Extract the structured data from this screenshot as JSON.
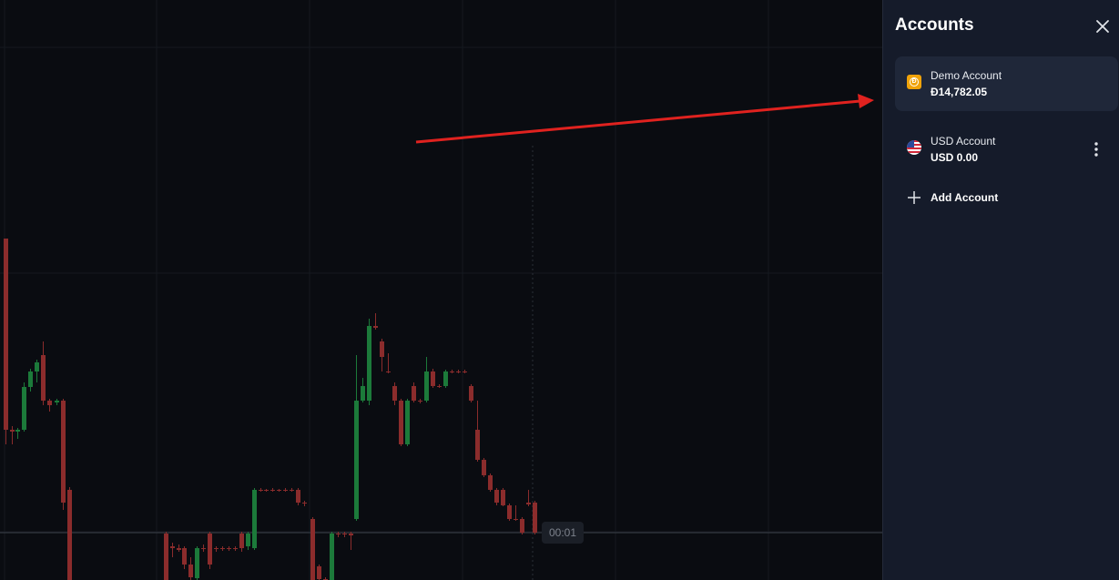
{
  "chart": {
    "timer": "00:01",
    "colors": {
      "up": "#1c7a3a",
      "down": "#8b2c2c",
      "grid": "#151920"
    }
  },
  "panel": {
    "title": "Accounts",
    "close_icon": "close-icon",
    "accounts": [
      {
        "name": "Demo Account",
        "balance": "Đ14,782.05",
        "icon": "demo-coin-icon",
        "active": true
      },
      {
        "name": "USD Account",
        "balance": "USD 0.00",
        "icon": "us-flag-icon",
        "active": false
      }
    ],
    "add_label": "Add Account",
    "accent": "#f0a30a"
  }
}
